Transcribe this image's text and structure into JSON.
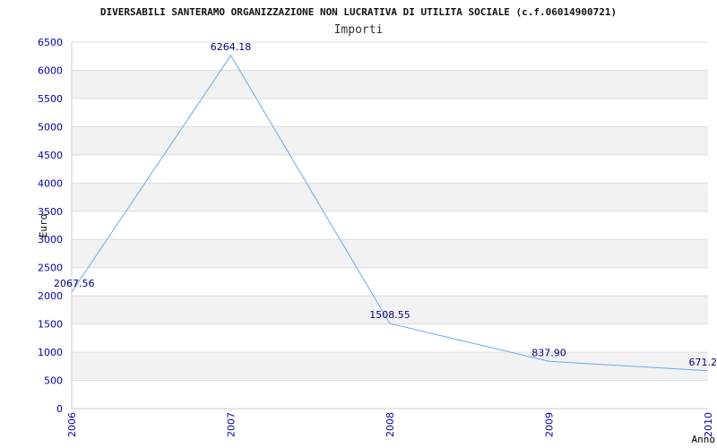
{
  "chart_data": {
    "type": "line",
    "title": "DIVERSABILI SANTERAMO ORGANIZZAZIONE NON LUCRATIVA DI UTILITA SOCIALE (c.f.06014900721)",
    "subtitle": "Importi",
    "xlabel": "Anno",
    "ylabel": "Euro",
    "x": [
      "2006",
      "2007",
      "2008",
      "2009",
      "2010"
    ],
    "series": [
      {
        "values": [
          2067.56,
          6264.18,
          1508.55,
          837.9,
          671.2
        ],
        "labels": [
          "2067.56",
          "6264.18",
          "1508.55",
          "837.90",
          "671.2"
        ]
      }
    ],
    "ylim": [
      0,
      6500
    ],
    "ytick_step": 500,
    "yticks": [
      "0",
      "500",
      "1000",
      "1500",
      "2000",
      "2500",
      "3000",
      "3500",
      "4000",
      "4500",
      "5000",
      "5500",
      "6000",
      "6500"
    ],
    "grid": "horizontal alternating bands",
    "colors": {
      "line": "#66aaee",
      "band": "#f2f2f2",
      "grid": "#dddddd",
      "tick_text": "#0000aa",
      "label_text": "#000080"
    }
  }
}
